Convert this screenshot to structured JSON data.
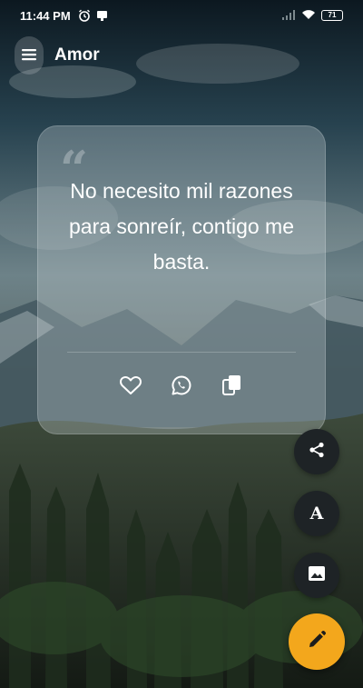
{
  "status_bar": {
    "time": "11:44 PM",
    "battery": "71"
  },
  "appbar": {
    "title": "Amor"
  },
  "quote": {
    "text": "No necesito mil razones para sonreír, contigo me basta."
  },
  "icons": {
    "menu": "menu-icon",
    "alarm": "alarm-icon",
    "notification": "notification-icon",
    "signal": "signal-icon",
    "wifi": "wifi-icon",
    "battery": "battery-icon",
    "quote_mark": "quote-mark-icon",
    "favorite": "heart-icon",
    "whatsapp": "whatsapp-icon",
    "copy": "copy-icon",
    "share": "share-icon",
    "font": "font-icon",
    "image": "image-icon",
    "edit": "pencil-icon"
  },
  "fab": {
    "font_label": "A"
  },
  "colors": {
    "accent": "#f3a71c",
    "fab_dark": "#1e2326",
    "text": "#ffffff"
  }
}
